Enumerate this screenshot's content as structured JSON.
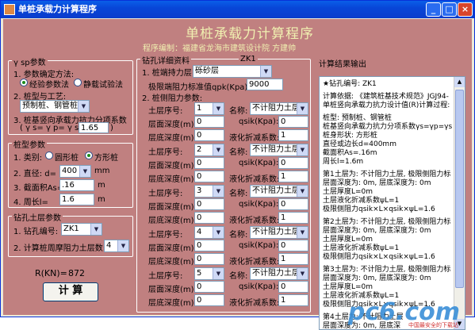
{
  "window": {
    "title": "单桩承载力计算程序"
  },
  "banner": {
    "title": "单桩承载力计算程序",
    "author": "程序编制：福建省龙海市建筑设计院  方建帅"
  },
  "gamma_group": {
    "title": "γ sp参数",
    "q1": "1. 参数确定方法:",
    "opt_exp": "经验参数法",
    "opt_static": "静载试验法",
    "q2": "2. 桩型与工艺:",
    "pile_type": "预制桩、钢管桩",
    "q3": "3. 桩基竖向承载力抗力分项系数",
    "q3b": "( γ s= γ p= γ sp=",
    "gamma_value": "1.65",
    "close_paren": ")"
  },
  "pile_group": {
    "title": "桩型参数",
    "type_label": "1. 类别:",
    "opt_round": "圆形桩",
    "opt_square": "方形桩",
    "diameter_label": "2. 直径:  d=",
    "diameter": "400",
    "diameter_unit": "mm",
    "area_label": "3. 截面积As=",
    "area": ".16",
    "area_unit": "m",
    "perimeter_label": "4. 周长l=",
    "perimeter": "1.6",
    "perimeter_unit": "m"
  },
  "hole_group": {
    "title": "钻孔土层参数",
    "hole_no_label": "1. 钻孔编号:",
    "hole_no": "ZK1",
    "layers_label": "2. 计算桩周摩阻力土层数:",
    "layers": "4"
  },
  "result": {
    "label": "R(KN)=",
    "value": "872"
  },
  "calc_button": "计 算",
  "detail": {
    "title": "钻孔详细资料",
    "hole": "ZK1",
    "bearing_layer_label": "1. 桩端持力层",
    "bearing_layer": "砾砂层",
    "qpk_label": "极限端阻力标准值qpk(Kpa):",
    "qpk": "9000",
    "side_label": "2. 桩侧阻力参数:",
    "rows": [
      {
        "seq_label": "土层序号:",
        "seq": "1",
        "name_label": "名称:",
        "name": "不计阻力土层",
        "top_label": "层面深度(m):",
        "top": "0",
        "qsik_label": "qsik(Kpa):",
        "qsik": "0",
        "bottom_label": "层底深度(m):",
        "bottom": "0",
        "coef_label": "液化折减系数:",
        "coef": "1"
      },
      {
        "seq_label": "土层序号:",
        "seq": "2",
        "name_label": "名称:",
        "name": "不计阻力土层",
        "top_label": "层面深度(m):",
        "top": "0",
        "qsik_label": "qsik(Kpa):",
        "qsik": "0",
        "bottom_label": "层底深度(m):",
        "bottom": "0",
        "coef_label": "液化折减系数:",
        "coef": "1"
      },
      {
        "seq_label": "土层序号:",
        "seq": "3",
        "name_label": "名称:",
        "name": "不计阻力土层",
        "top_label": "层面深度(m):",
        "top": "0",
        "qsik_label": "qsik(Kpa):",
        "qsik": "0",
        "bottom_label": "层底深度(m):",
        "bottom": "0",
        "coef_label": "液化折减系数:",
        "coef": "1"
      },
      {
        "seq_label": "土层序号:",
        "seq": "4",
        "name_label": "名称:",
        "name": "不计阻力土层",
        "top_label": "层面深度(m):",
        "top": "0",
        "qsik_label": "qsik(Kpa):",
        "qsik": "0",
        "bottom_label": "层底深度(m):",
        "bottom": "0",
        "coef_label": "液化折减系数:",
        "coef": "1"
      },
      {
        "seq_label": "土层序号:",
        "seq": "5",
        "name_label": "名称:",
        "name": "不计阻力土层",
        "top_label": "层面深度(m):",
        "top": "0",
        "qsik_label": "qsik(Kpa):",
        "qsik": "0",
        "bottom_label": "层底深度(m):",
        "bottom": "0",
        "coef_label": "液化折减系数:",
        "coef": "1"
      }
    ]
  },
  "output": {
    "title": "计算结果输出",
    "lines": [
      "★钻孔编号: ZK1",
      "计算依据: 《建筑桩基技术规范》JGJ94-",
      "单桩竖向承载力抗力设计值(R)计算过程:",
      "桩型: 预制桩、钢管桩",
      "桩基竖向承载力抗力分项系数γs=γp=γs",
      "桩身形状: 方形桩",
      "直径或边长d=400mm",
      "截面积As=.16m",
      "周长l=1.6m",
      "第1土层为: 不计阻力土层, 极限侧阻力标",
      "层面深度为: 0m, 层底深度为: 0m",
      "土层厚度L=0m",
      "土层液化折减系数ψL=1",
      "极限侧阻力qsik×L×qsik×ψL=1.6",
      "第2土层为: 不计阻力土层, 极限侧阻力标",
      "层面深度为: 0m, 层底深度为: 0m",
      "土层厚度L=0m",
      "土层液化折减系数ψL=1",
      "极限侧阻力qsik×L×qsik×ψL=1.6",
      "第3土层为: 不计阻力土层, 极限侧阻力标",
      "层面深度为: 0m, 层底深度为: 0m",
      "土层厚度L=0m",
      "土层液化折减系数ψL=1",
      "极限侧阻力qsik×L×qsik×ψL=1.6",
      "第4土层为: 不计阻力土层",
      "层面深度为: 0m, 层底深"
    ]
  },
  "watermark": "pc6.com",
  "watermark_sub": "中国最安全的下载站"
}
